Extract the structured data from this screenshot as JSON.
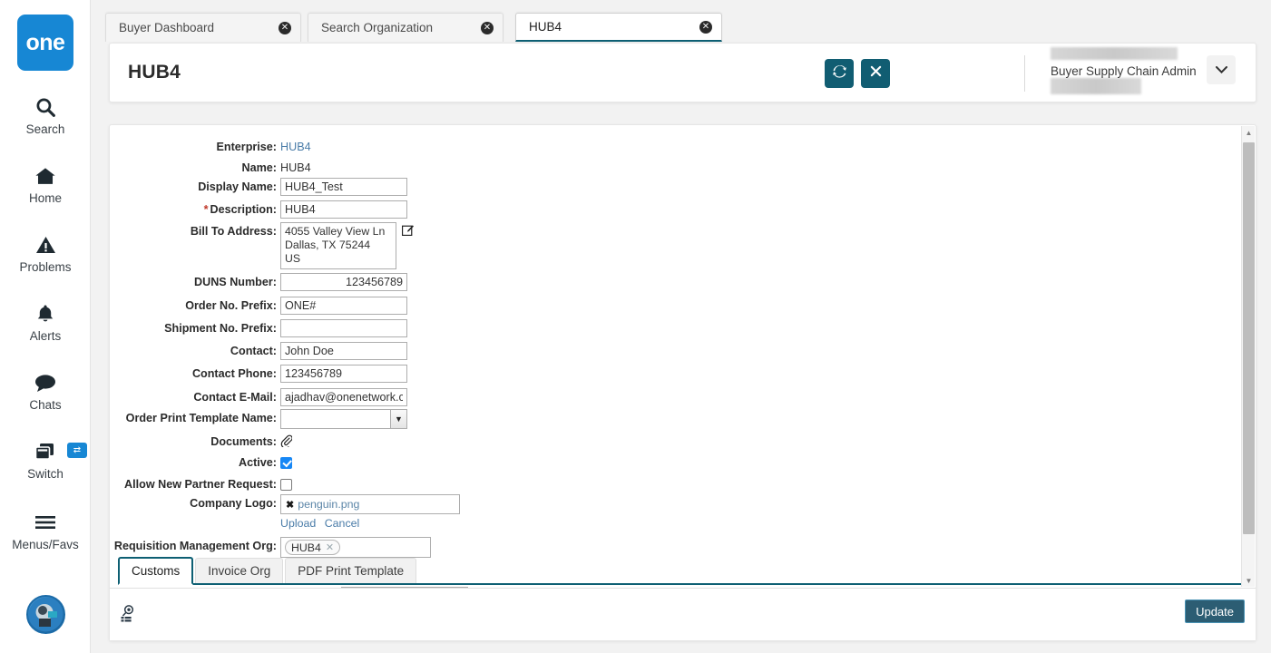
{
  "brand": {
    "logo_text": "one",
    "logo_color": "#1787d4"
  },
  "theme": {
    "accent_teal": "#115d72",
    "tab_underline": "#0d5f73",
    "badge_red": "#b3141a",
    "link_blue": "#4a7ca8"
  },
  "left_rail": {
    "items": [
      {
        "label": "Search",
        "icon": "search-icon"
      },
      {
        "label": "Home",
        "icon": "home-icon"
      },
      {
        "label": "Problems",
        "icon": "warning-triangle-icon"
      },
      {
        "label": "Alerts",
        "icon": "bell-icon"
      },
      {
        "label": "Chats",
        "icon": "chat-bubble-icon"
      },
      {
        "label": "Switch",
        "icon": "windows-stack-icon",
        "badge_icon": "swap-arrows-icon"
      },
      {
        "label": "Menus/Favs",
        "icon": "hamburger-icon"
      }
    ],
    "avatar_icon": "user-avatar"
  },
  "browser_tabs": [
    {
      "label": "Buyer Dashboard",
      "active": false
    },
    {
      "label": "Search Organization",
      "active": false
    },
    {
      "label": "HUB4",
      "active": true
    }
  ],
  "header": {
    "title": "HUB4",
    "refresh_icon": "refresh-icon",
    "close_icon": "close-x-icon",
    "menu_icon": "hamburger-menu-icon",
    "menu_badge_icon": "star-icon",
    "user_name": "Buyer Supply Chain Admin",
    "user_caret_icon": "chevron-down-icon"
  },
  "form": {
    "fields": [
      {
        "label": "Enterprise",
        "type": "link",
        "value": "HUB4"
      },
      {
        "label": "Name",
        "type": "text",
        "value": "HUB4"
      },
      {
        "label": "Display Name",
        "type": "input",
        "value": "HUB4_Test"
      },
      {
        "label": "Description",
        "type": "input",
        "value": "HUB4",
        "required": true
      },
      {
        "label": "Bill To Address",
        "type": "textarea",
        "value": "4055 Valley View Ln\nDallas, TX 75244\nUS",
        "edit_icon": "edit-pencil-icon"
      },
      {
        "label": "DUNS Number",
        "type": "input-num",
        "value": "123456789"
      },
      {
        "label": "Order No. Prefix",
        "type": "input",
        "value": "ONE#"
      },
      {
        "label": "Shipment No. Prefix",
        "type": "input",
        "value": ""
      },
      {
        "label": "Contact",
        "type": "input",
        "value": "John Doe"
      },
      {
        "label": "Contact Phone",
        "type": "input",
        "value": "123456789"
      },
      {
        "label": "Contact E-Mail",
        "type": "input",
        "value": "ajadhav@onenetwork.c"
      },
      {
        "label": "Order Print Template Name",
        "type": "select",
        "value": ""
      },
      {
        "label": "Documents",
        "type": "icon",
        "icon": "paperclip-icon"
      },
      {
        "label": "Active",
        "type": "checkbox",
        "checked": true
      },
      {
        "label": "Allow New Partner Request",
        "type": "checkbox",
        "checked": false
      },
      {
        "label": "Company Logo",
        "type": "file",
        "value": "penguin.png",
        "remove_icon": "remove-x-icon",
        "upload_label": "Upload",
        "cancel_label": "Cancel"
      },
      {
        "label": "Requisition Management Org",
        "type": "chips",
        "chips": [
          "HUB4"
        ]
      }
    ]
  },
  "content_tabs": [
    {
      "label": "Customs",
      "active": true
    },
    {
      "label": "Invoice Org",
      "active": false
    },
    {
      "label": "PDF Print Template",
      "active": false
    }
  ],
  "footer": {
    "detail_icon": "detail-list-icon",
    "update_label": "Update"
  },
  "scrollbar": {
    "up_icon": "caret-up-icon",
    "down_icon": "caret-down-icon"
  }
}
